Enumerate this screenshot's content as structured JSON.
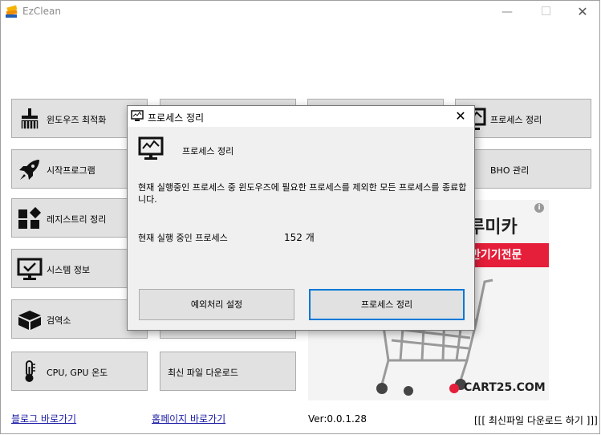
{
  "window": {
    "title": "EzClean",
    "minimize_glyph": "—",
    "close_glyph": "✕"
  },
  "tiles": [
    {
      "label": "윈도우즈 최적화",
      "icon": "broom-icon"
    },
    {
      "label": "",
      "icon": ""
    },
    {
      "label": "",
      "icon": ""
    },
    {
      "label": "프로세스 정리",
      "icon": "monitor-chart-icon"
    },
    {
      "label": "시작프로그램",
      "icon": "rocket-icon"
    },
    {
      "label": "BHO 관리",
      "icon": ""
    },
    {
      "label": "레지스트리 정리",
      "icon": "blocks-icon"
    },
    {
      "label": "시스템 정보",
      "icon": "monitor-check-icon"
    },
    {
      "label": "검역소",
      "icon": "box-icon"
    },
    {
      "label": "CPU, GPU 온도",
      "icon": "thermometer-icon"
    },
    {
      "label": "최신 파일 다운로드",
      "icon": ""
    }
  ],
  "ad": {
    "title1": "루미카",
    "title2": "반기기전문",
    "info": "i",
    "logo": "CART25.COM"
  },
  "footer": {
    "blog_link": "블로그 바로가기",
    "home_link": "홈페이지 바로가기",
    "version": "Ver:0.0.1.28",
    "download_link": "[[[ 최신파일 다운로드 하기 ]]]"
  },
  "dialog": {
    "title": "프로세스 정리",
    "close_glyph": "✕",
    "heading": "프로세스 정리",
    "description": "현재 실행중인 프로세스 중 윈도우즈에 필요한 프로세스를 제외한 모든 프로세스를 종료합니다.",
    "count_label": "현재 실행 중인 프로세스",
    "count_value": "152 개",
    "exception_button": "예외처리 설정",
    "clean_button": "프로세스 정리"
  },
  "colors": {
    "accent": "#0078d7",
    "ad_red": "#e51e3a"
  }
}
